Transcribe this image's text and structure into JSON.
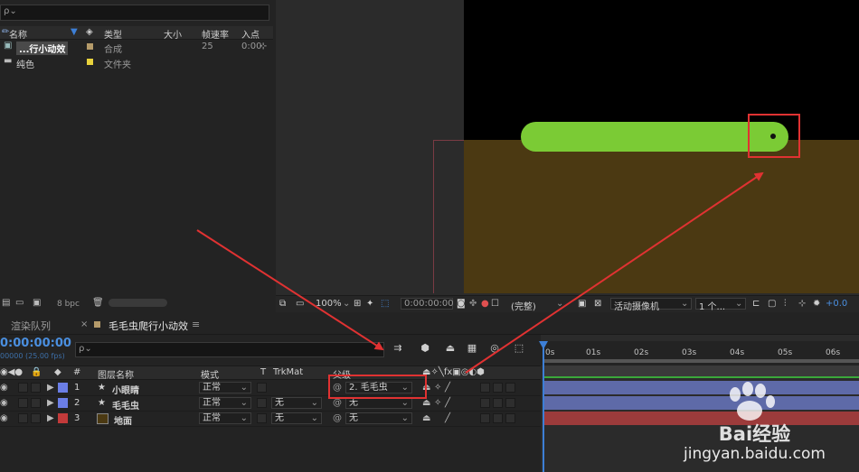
{
  "project": {
    "search_icon": "search-icon",
    "headers": {
      "name": "名称",
      "type": "类型",
      "size": "大小",
      "framerate": "帧速率",
      "inpoint": "入点"
    },
    "items": [
      {
        "name": "...行小动效",
        "type": "合成",
        "framerate": "25",
        "inpoint": "0:00",
        "swatch": "#b59b6a"
      },
      {
        "name": "纯色",
        "type": "文件夹",
        "framerate": "",
        "inpoint": "",
        "swatch": "#e8d23c"
      }
    ],
    "bit_depth": "8 bpc"
  },
  "viewer": {
    "zoom": "100%",
    "timecode": "0:00:00:00",
    "resolution": "(完整)",
    "camera": "活动摄像机",
    "views": "1 个...",
    "exposure": "+0.0",
    "colors": {
      "background": "#000000",
      "ground": "#4b3912",
      "worm": "#7bcb35"
    }
  },
  "tabs": {
    "render_queue": "渲染队列",
    "comp": "毛毛虫爬行小动效",
    "menu_glyph": "≡",
    "close_glyph": "×"
  },
  "timeline": {
    "timecode": "0:00:00:00",
    "fps": "00000 (25.00 fps)",
    "search_glyph": "ρ⌄",
    "columns": {
      "num": "#",
      "name": "图层名称",
      "mode": "模式",
      "t": "T",
      "trkmat": "TrkMat",
      "parent": "父级"
    },
    "layers": [
      {
        "num": "1",
        "name": "小眼睛",
        "mode": "正常",
        "trkmat": "",
        "parent": "2. 毛毛虫",
        "label_color": "#6b7ee6",
        "bar_color": "#5e6aa8",
        "shape": true
      },
      {
        "num": "2",
        "name": "毛毛虫",
        "mode": "正常",
        "trkmat": "无",
        "parent": "无",
        "label_color": "#6b7ee6",
        "bar_color": "#5e6aa8",
        "shape": true
      },
      {
        "num": "3",
        "name": "地面",
        "mode": "正常",
        "trkmat": "无",
        "parent": "无",
        "label_color": "#c23a3a",
        "bar_color": "#9c3b3b",
        "shape": false
      }
    ],
    "ruler": [
      "0s",
      "01s",
      "02s",
      "03s",
      "04s",
      "05s",
      "06s"
    ]
  },
  "annotation": {
    "color": "#e03232"
  },
  "watermark": {
    "brand": "Bai经验",
    "url": "jingyan.baidu.com"
  }
}
